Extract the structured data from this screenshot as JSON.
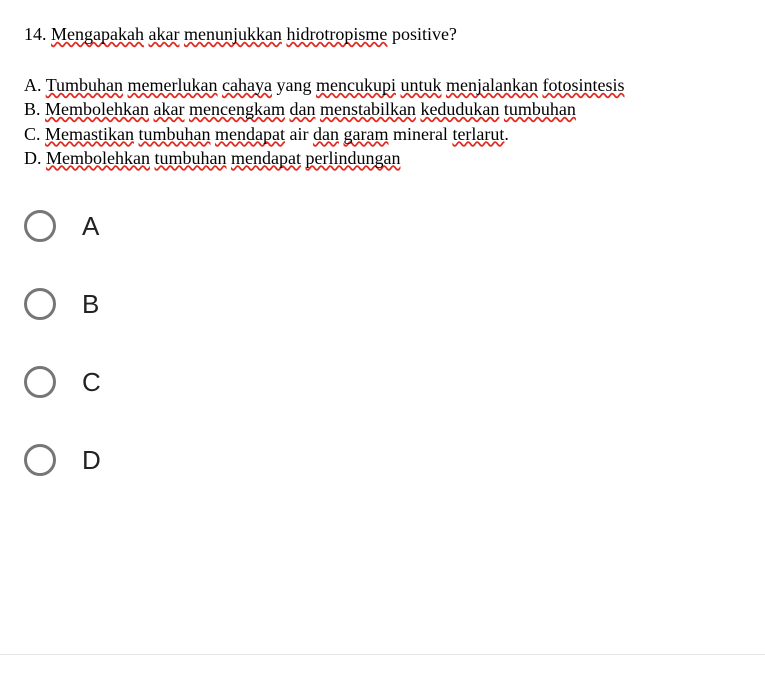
{
  "question": {
    "number": "14.",
    "prefix_plain": " ",
    "seg1_sq": "Mengapakah",
    "seg2_plain": " ",
    "seg3_sq": "akar",
    "seg4_plain": " ",
    "seg5_sq": "menunjukkan",
    "seg6_plain": " ",
    "seg7_sq": "hidrotropisme",
    "seg8_plain": " positive?"
  },
  "answers": {
    "a": {
      "label": "A.",
      "s1": " ",
      "w1": "Tumbuhan",
      "s2": " ",
      "w2": "memerlukan",
      "s3": " ",
      "w3": "cahaya",
      "s4": " yang ",
      "w4": "mencukupi",
      "s5": " ",
      "w5": "untuk",
      "s6": " ",
      "w6": "menjalankan",
      "s7": " ",
      "w7": "fotosintesis"
    },
    "b": {
      "label": "B.",
      "s1": " ",
      "w1": "Membolehkan",
      "s2": " ",
      "w2": "akar",
      "s3": " ",
      "w3": "mencengkam",
      "s4": " ",
      "w4": "dan",
      "s5": " ",
      "w5": "menstabilkan",
      "s6": " ",
      "w6": "kedudukan",
      "s7": " ",
      "w7": "tumbuhan"
    },
    "c": {
      "label": "C.",
      "s1": " ",
      "w1": "Memastikan",
      "s2": " ",
      "w2": "tumbuhan",
      "s3": " ",
      "w3": "mendapat",
      "s4": " air ",
      "w4": "dan",
      "s5": " ",
      "w5": "garam",
      "s6": " mineral ",
      "w6": "terlarut",
      "s7": "."
    },
    "d": {
      "label": "D.",
      "s1": " ",
      "w1": "Membolehkan",
      "s2": " ",
      "w2": "tumbuhan",
      "s3": " ",
      "w3": "mendapat",
      "s4": " ",
      "w4": "perlindungan"
    }
  },
  "options": {
    "a": "A",
    "b": "B",
    "c": "C",
    "d": "D"
  }
}
